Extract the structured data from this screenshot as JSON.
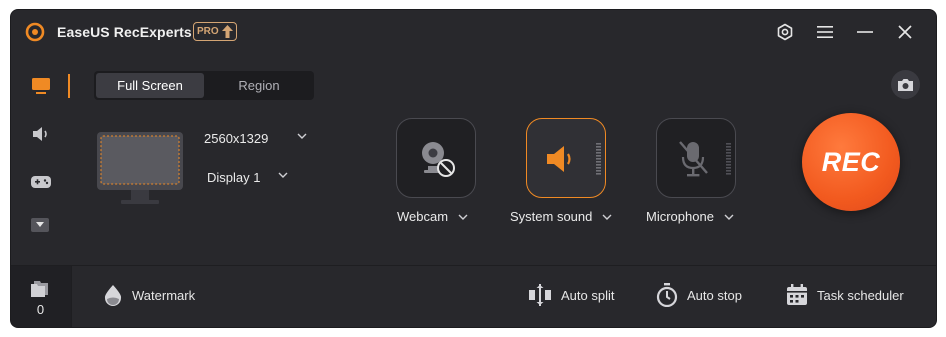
{
  "app": {
    "title": "EaseUS RecExperts",
    "pro_badge": "PRO",
    "accent_color": "#f08a24",
    "rec_color": "#f25a1f"
  },
  "titlebar_icons": [
    "settings-icon",
    "menu-icon",
    "minimize-icon",
    "close-icon"
  ],
  "sidebar": {
    "items": [
      {
        "name": "screen",
        "icon": "monitor-icon",
        "active": true
      },
      {
        "name": "audio",
        "icon": "speaker-icon",
        "active": false
      },
      {
        "name": "game",
        "icon": "gamepad-icon",
        "active": false
      },
      {
        "name": "more",
        "icon": "chevron-down-icon",
        "active": false
      }
    ],
    "files_count": "0"
  },
  "mode_tabs": [
    {
      "label": "Full Screen",
      "active": true
    },
    {
      "label": "Region",
      "active": false
    }
  ],
  "display": {
    "resolution": "2560x1329",
    "display_name": "Display 1"
  },
  "devices": {
    "webcam": {
      "label": "Webcam",
      "enabled": false
    },
    "system_sound": {
      "label": "System sound",
      "enabled": true
    },
    "microphone": {
      "label": "Microphone",
      "enabled": false
    }
  },
  "rec_button": {
    "label": "REC"
  },
  "bottom": {
    "watermark": "Watermark",
    "auto_split": "Auto split",
    "auto_stop": "Auto stop",
    "task_scheduler": "Task scheduler"
  }
}
